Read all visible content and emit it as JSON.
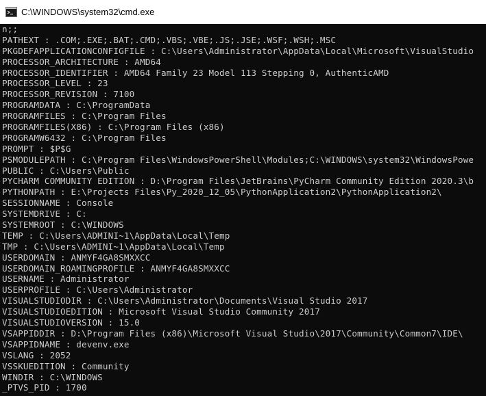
{
  "window": {
    "title": "C:\\WINDOWS\\system32\\cmd.exe",
    "icon": "cmd-console-icon"
  },
  "console": {
    "lines": [
      "n;;",
      "PATHEXT : .COM;.EXE;.BAT;.CMD;.VBS;.VBE;.JS;.JSE;.WSF;.WSH;.MSC",
      "PKGDEFAPPLICATIONCONFIGFILE : C:\\Users\\Administrator\\AppData\\Local\\Microsoft\\VisualStudio",
      "PROCESSOR_ARCHITECTURE : AMD64",
      "PROCESSOR_IDENTIFIER : AMD64 Family 23 Model 113 Stepping 0, AuthenticAMD",
      "PROCESSOR_LEVEL : 23",
      "PROCESSOR_REVISION : 7100",
      "PROGRAMDATA : C:\\ProgramData",
      "PROGRAMFILES : C:\\Program Files",
      "PROGRAMFILES(X86) : C:\\Program Files (x86)",
      "PROGRAMW6432 : C:\\Program Files",
      "PROMPT : $P$G",
      "PSMODULEPATH : C:\\Program Files\\WindowsPowerShell\\Modules;C:\\WINDOWS\\system32\\WindowsPowe",
      "PUBLIC : C:\\Users\\Public",
      "PYCHARM COMMUNITY EDITION : D:\\Program Files\\JetBrains\\PyCharm Community Edition 2020.3\\b",
      "PYTHONPATH : E:\\Projects Files\\Py_2020_12_05\\PythonApplication2\\PythonApplication2\\",
      "SESSIONNAME : Console",
      "SYSTEMDRIVE : C:",
      "SYSTEMROOT : C:\\WINDOWS",
      "TEMP : C:\\Users\\ADMINI~1\\AppData\\Local\\Temp",
      "TMP : C:\\Users\\ADMINI~1\\AppData\\Local\\Temp",
      "USERDOMAIN : ANMYF4GA8SMXXCC",
      "USERDOMAIN_ROAMINGPROFILE : ANMYF4GA8SMXXCC",
      "USERNAME : Administrator",
      "USERPROFILE : C:\\Users\\Administrator",
      "VISUALSTUDIODIR : C:\\Users\\Administrator\\Documents\\Visual Studio 2017",
      "VISUALSTUDIOEDITION : Microsoft Visual Studio Community 2017",
      "VISUALSTUDIOVERSION : 15.0",
      "VSAPPIDDIR : D:\\Program Files (x86)\\Microsoft Visual Studio\\2017\\Community\\Common7\\IDE\\",
      "VSAPPIDNAME : devenv.exe",
      "VSLANG : 2052",
      "VSSKUEDITION : Community",
      "WINDIR : C:\\WINDOWS",
      "_PTVS_PID : 1700"
    ]
  },
  "colors": {
    "console_background": "#0c0c0c",
    "console_text": "#cccccc",
    "titlebar_background": "#ffffff"
  }
}
